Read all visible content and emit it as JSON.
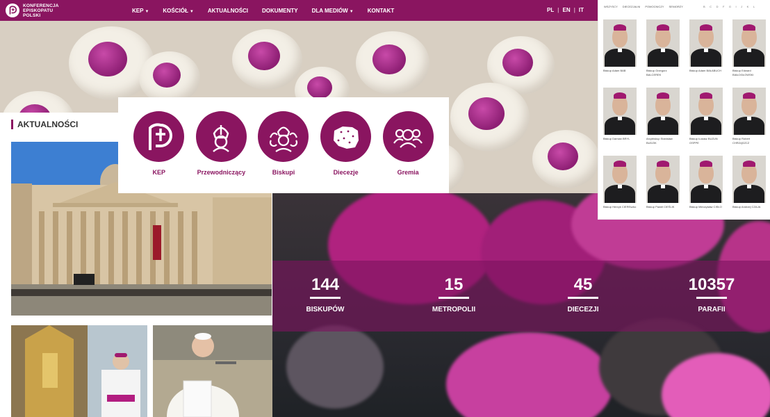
{
  "header": {
    "logo_lines": [
      "KONFERENCJA",
      "EPISKOPATU",
      "POLSKI"
    ],
    "nav": [
      {
        "label": "KEP",
        "dropdown": true
      },
      {
        "label": "KOŚCIÓŁ",
        "dropdown": true
      },
      {
        "label": "AKTUALNOŚCI",
        "dropdown": false
      },
      {
        "label": "DOKUMENTY",
        "dropdown": false
      },
      {
        "label": "DLA MEDIÓW",
        "dropdown": true
      },
      {
        "label": "KONTAKT",
        "dropdown": false
      }
    ],
    "languages": [
      "PL",
      "EN",
      "IT"
    ]
  },
  "quicklinks": [
    "KEP",
    "Przewodniczący",
    "Biskupi",
    "Diecezje",
    "Gremia"
  ],
  "news": {
    "heading": "AKTUALNOŚCI"
  },
  "stats": [
    {
      "value": "144",
      "label": "BISKUPÓW"
    },
    {
      "value": "15",
      "label": "METROPOLII"
    },
    {
      "value": "45",
      "label": "DIECEZJI"
    },
    {
      "value": "10357",
      "label": "PARAFII"
    }
  ],
  "directory": {
    "filters": [
      "WSZYSCY",
      "DIECEZJALNI",
      "POMOCNICZY",
      "SENIORZY"
    ],
    "letters": [
      "B",
      "C",
      "D",
      "F",
      "G",
      "I",
      "J",
      "K",
      "L"
    ],
    "bishops": [
      "Biskup Adam BAB",
      "Biskup Grzegorz BALCEREK",
      "Biskup Adam BAŁABUCH",
      "Biskup Edward BIAŁOGŁOWSKI",
      "Biskup Damian BRYL",
      "Arcybiskup Stanisław BUDZIK",
      "Biskup Łukasz BUZUN OSPPE",
      "Biskup Robert CHRZĄSZCZ",
      "Biskup Henryk CIEREszko",
      "Biskup Paweł CIEŚLIK",
      "Biskup Mieczysław CISŁO",
      "Biskup Andrzej CZAJA"
    ]
  },
  "colors": {
    "brand": "#8a1560",
    "band": "#7d145f"
  }
}
